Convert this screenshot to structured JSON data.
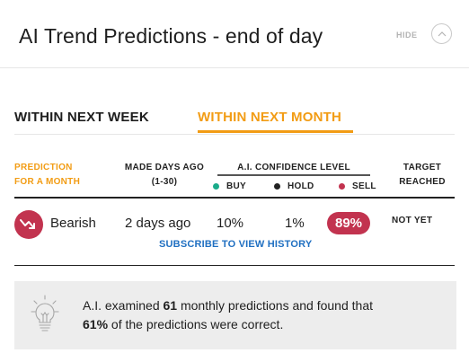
{
  "header": {
    "title": "AI Trend Predictions - end of day",
    "hide_label": "HIDE",
    "collapse_icon": "chevron-up-icon"
  },
  "tabs": [
    {
      "label": "WITHIN NEXT WEEK",
      "active": false
    },
    {
      "label": "WITHIN NEXT MONTH",
      "active": true
    }
  ],
  "table": {
    "headers": {
      "prediction": "PREDICTION FOR A MONTH",
      "prediction_line1": "PREDICTION",
      "prediction_line2": "FOR A MONTH",
      "made_line1": "MADE DAYS AGO",
      "made_line2": "(1-30)",
      "confidence": "A.I. CONFIDENCE LEVEL",
      "target_line1": "TARGET",
      "target_line2": "REACHED"
    },
    "legend": {
      "buy": "BUY",
      "hold": "HOLD",
      "sell": "SELL"
    },
    "row": {
      "prediction": "Bearish",
      "prediction_icon": "trend-down-icon",
      "made": "2 days ago",
      "buy": "10%",
      "hold": "1%",
      "sell": "89%",
      "target_reached": "NOT YET"
    },
    "subscribe_label": "SUBSCRIBE TO VIEW HISTORY"
  },
  "summary": {
    "icon": "lightbulb-icon",
    "text_1": "A.I. examined ",
    "count": "61",
    "text_2": " monthly predictions and found that",
    "percent": "61%",
    "text_3": " of the predictions were correct."
  },
  "colors": {
    "accent": "#f29c14",
    "buy": "#1aab8a",
    "hold": "#222222",
    "sell": "#c2334f",
    "link": "#1f6fc1",
    "summary_bg": "#ededed"
  }
}
